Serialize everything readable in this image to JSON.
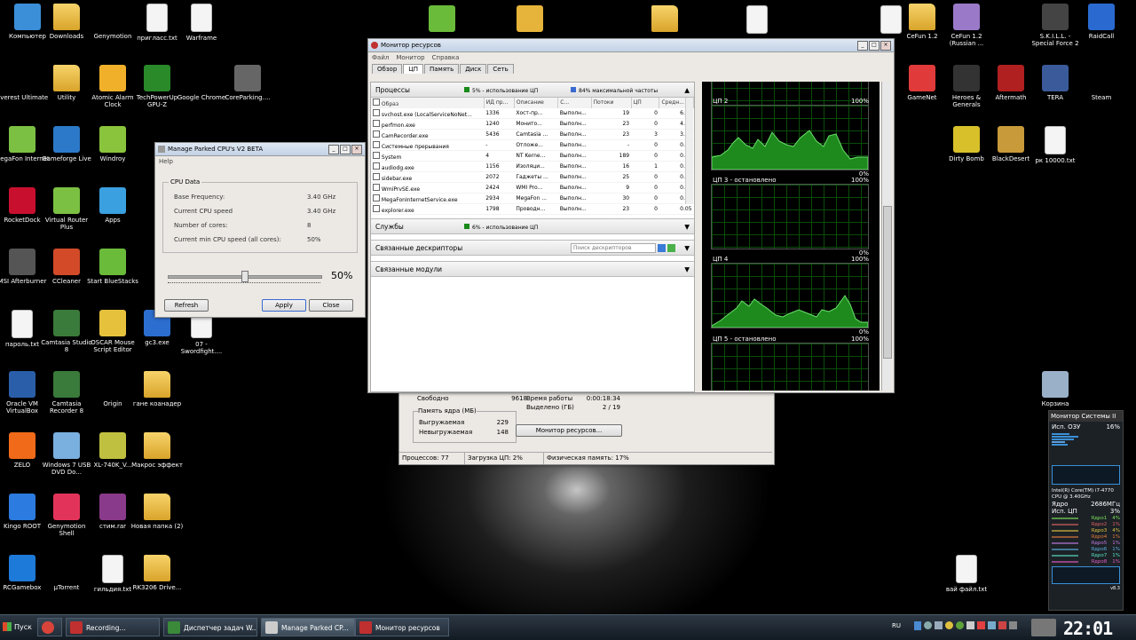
{
  "desktop_icons": [
    {
      "label": "Компьютер",
      "icon": "computer-icon",
      "color": "#3b8fd8"
    },
    {
      "label": "Downloads",
      "icon": "folder-icon",
      "color": "#e8b84a"
    },
    {
      "label": "Genymotion",
      "icon": "genymotion-icon",
      "color": "#e2345a"
    },
    {
      "label": "пригласс.txt",
      "icon": "text-file-icon",
      "color": "#f4f4f4"
    },
    {
      "label": "Warframe",
      "icon": "document-icon",
      "color": "#f4f4f4"
    },
    {
      "label": "Everest Ultimate",
      "icon": "info-icon",
      "color": "#e87d13"
    },
    {
      "label": "Utility",
      "icon": "folder-icon",
      "color": "#e8b84a"
    },
    {
      "label": "Atomic Alarm Clock",
      "icon": "alarm-clock-icon",
      "color": "#f0b02a"
    },
    {
      "label": "TechPowerUp GPU-Z",
      "icon": "gpu-icon",
      "color": "#2a8a2a"
    },
    {
      "label": "Google Chrome",
      "icon": "chrome-icon",
      "color": "#d9443a"
    },
    {
      "label": "CoreParking....",
      "icon": "chip-icon",
      "color": "#666"
    },
    {
      "label": "MegaFon Internet",
      "icon": "signal-icon",
      "color": "#7bc043"
    },
    {
      "label": "Gameforge Live",
      "icon": "gameforge-icon",
      "color": "#2c79c9"
    },
    {
      "label": "Windroy",
      "icon": "android-icon",
      "color": "#8ac43c"
    },
    {
      "label": "RocketDock",
      "icon": "rocket-icon",
      "color": "#c8102e"
    },
    {
      "label": "Virtual Router Plus",
      "icon": "signal-icon",
      "color": "#7bc043"
    },
    {
      "label": "Apps",
      "icon": "apps-icon",
      "color": "#3aa0e0"
    },
    {
      "label": "MSI Afterburner",
      "icon": "afterburner-icon",
      "color": "#555"
    },
    {
      "label": "CCleaner",
      "icon": "ccleaner-icon",
      "color": "#d24a28"
    },
    {
      "label": "Start BlueStacks",
      "icon": "bluestacks-icon",
      "color": "#6bbb3a"
    },
    {
      "label": "пароль.txt",
      "icon": "text-file-icon",
      "color": "#f4f4f4"
    },
    {
      "label": "Camtasia Studio 8",
      "icon": "camtasia-icon",
      "color": "#3a7a3a"
    },
    {
      "label": "OSCAR Mouse Script Editor",
      "icon": "oscar-icon",
      "color": "#e6c23c"
    },
    {
      "label": "gc3.exe",
      "icon": "exe-icon",
      "color": "#2c6ed0"
    },
    {
      "label": "07 - Swordfight....",
      "icon": "media-file-icon",
      "color": "#f4f4f4"
    },
    {
      "label": "Oracle VM VirtualBox",
      "icon": "virtualbox-icon",
      "color": "#2b5ea8"
    },
    {
      "label": "Camtasia Recorder 8",
      "icon": "camtasia-recorder-icon",
      "color": "#3a7a3a"
    },
    {
      "label": "Origin",
      "icon": "origin-icon",
      "color": "#f26c1f"
    },
    {
      "label": "гане коанадер",
      "icon": "folder-icon",
      "color": "#e8b84a"
    },
    {
      "label": "ZELO",
      "icon": "zelo-icon",
      "color": "#f06a19"
    },
    {
      "label": "Windows 7 USB DVD Do...",
      "icon": "usb-icon",
      "color": "#7ab0e0"
    },
    {
      "label": "XL-740K_V...",
      "icon": "xl-icon",
      "color": "#c0c040"
    },
    {
      "label": "Макрос эффект",
      "icon": "folder-icon",
      "color": "#e8b84a"
    },
    {
      "label": "Kingo ROOT",
      "icon": "kingo-icon",
      "color": "#2c7be0"
    },
    {
      "label": "Genymotion Shell",
      "icon": "genymotion-shell-icon",
      "color": "#e2345a"
    },
    {
      "label": "стим.rar",
      "icon": "archive-icon",
      "color": "#8a3a8a"
    },
    {
      "label": "Новая папка (2)",
      "icon": "folder-icon",
      "color": "#e8b84a"
    },
    {
      "label": "RCGamebox",
      "icon": "rcgamebox-icon",
      "color": "#1e7ad8"
    },
    {
      "label": "µTorrent",
      "icon": "utorrent-icon",
      "color": "#5ea23a"
    },
    {
      "label": "гильдия.txt",
      "icon": "text-file-icon",
      "color": "#f4f4f4"
    },
    {
      "label": "RK3206 Drive...",
      "icon": "folder-icon",
      "color": "#e8b84a"
    },
    {
      "label": "CeFun 1.2",
      "icon": "folder-icon",
      "color": "#e8b84a"
    },
    {
      "label": "CeFun 1.2 (Russian ...",
      "icon": "cefun-icon",
      "color": "#9a7ac8"
    },
    {
      "label": "S.K.I.L.L. - Special Force 2",
      "icon": "sf2-icon",
      "color": "#444"
    },
    {
      "label": "RaidCall",
      "icon": "raidcall-icon",
      "color": "#2a6ad0"
    },
    {
      "label": "GameNet",
      "icon": "gamenet-icon",
      "color": "#e03a3a"
    },
    {
      "label": "Heroes & Generals",
      "icon": "hg-icon",
      "color": "#333"
    },
    {
      "label": "Aftermath",
      "icon": "aftermath-icon",
      "color": "#b02020"
    },
    {
      "label": "TERA",
      "icon": "tera-icon",
      "color": "#3a5a9a"
    },
    {
      "label": "Steam",
      "icon": "steam-icon",
      "color": "#1b4a7a"
    },
    {
      "label": "Dirty Bomb",
      "icon": "dirtybomb-icon",
      "color": "#d8c02a"
    },
    {
      "label": "BlackDesert",
      "icon": "blackdesert-icon",
      "color": "#c89a3a"
    },
    {
      "label": "рк 10000.txt",
      "icon": "text-file-icon",
      "color": "#f4f4f4"
    },
    {
      "label": "Корзина",
      "icon": "recycle-bin-icon",
      "color": "#9ab0c8"
    },
    {
      "label": "вай файл.txt",
      "icon": "text-file-icon",
      "color": "#f4f4f4"
    }
  ],
  "top_icons": [
    {
      "icon": "bluestacks-icon",
      "color": "#6bbb3a"
    },
    {
      "icon": "uac-shield-icon",
      "color": "#e6b43a"
    },
    {
      "icon": "folder-icon",
      "color": "#e8b84a"
    },
    {
      "icon": "mp3-file-icon",
      "color": "#f4f4f4"
    },
    {
      "icon": "search-file-icon",
      "color": "#f4f4f4"
    }
  ],
  "resmon": {
    "title": "Монитор ресурсов",
    "menu": [
      "Файл",
      "Монитор",
      "Справка"
    ],
    "tabs": [
      "Обзор",
      "ЦП",
      "Память",
      "Диск",
      "Сеть"
    ],
    "processes_header": "Процессы",
    "processes_usage": "5% - использование ЦП",
    "processes_freq": "84% максимальной частоты",
    "columns": [
      "Образ",
      "ИД пр...",
      "Описание",
      "С...",
      "Потоки",
      "ЦП",
      "Средн..."
    ],
    "rows": [
      [
        "svchost.exe (LocalServiceNoNet...",
        "1336",
        "Хост-пр...",
        "Выполн...",
        "19",
        "0",
        "6.03"
      ],
      [
        "perfmon.exe",
        "1240",
        "Монито...",
        "Выполн...",
        "23",
        "0",
        "4.27"
      ],
      [
        "CamRecorder.exe",
        "5436",
        "Camtasia ...",
        "Выполн...",
        "23",
        "3",
        "3.83"
      ],
      [
        "Системные прерывания",
        "-",
        "Отложе...",
        "Выполн...",
        "-",
        "0",
        "0.91"
      ],
      [
        "System",
        "4",
        "NT Kerne...",
        "Выполн...",
        "189",
        "0",
        "0.85"
      ],
      [
        "audiodg.exe",
        "1156",
        "Изоляци...",
        "Выполн...",
        "16",
        "1",
        "0.35"
      ],
      [
        "sidebar.exe",
        "2072",
        "Гаджеты ...",
        "Выполн...",
        "25",
        "0",
        "0.35"
      ],
      [
        "WmiPrvSE.exe",
        "2424",
        "WMI Pro...",
        "Выполн...",
        "9",
        "0",
        "0.32"
      ],
      [
        "MegaFonInternetService.exe",
        "2934",
        "MegaFon ...",
        "Выполн...",
        "30",
        "0",
        "0.09"
      ],
      [
        "explorer.exe",
        "1798",
        "Проводн...",
        "Выполн...",
        "23",
        "0",
        "0.05"
      ]
    ],
    "services_header": "Службы",
    "services_usage": "6% - использование ЦП",
    "handles_header": "Связанные дескрипторы",
    "handles_search_placeholder": "Поиск дескрипторов",
    "modules_header": "Связанные модули",
    "cpu_graphs": [
      {
        "label": "",
        "top": "",
        "bottom": "0%",
        "parked": false,
        "partial": true
      },
      {
        "label": "ЦП 2",
        "top": "100%",
        "bottom": "0%",
        "parked": false
      },
      {
        "label": "ЦП 3 - остановлено",
        "top": "100%",
        "bottom": "0%",
        "parked": true
      },
      {
        "label": "ЦП 4",
        "top": "100%",
        "bottom": "0%",
        "parked": false
      },
      {
        "label": "ЦП 5 - остановлено",
        "top": "100%",
        "bottom": "",
        "parked": true
      }
    ]
  },
  "taskmgr": {
    "free_label": "Свободно",
    "free_value": "9618",
    "uptime_label": "Время работы",
    "uptime_value": "0:00:18:34",
    "committed_label": "Выделено (ГБ)",
    "committed_value": "2 / 19",
    "kernel_memory_label": "Память ядра (МБ)",
    "paged_label": "Выгружаемая",
    "paged_value": "229",
    "nonpaged_label": "Невыгружаемая",
    "nonpaged_value": "148",
    "resmon_button": "Монитор ресурсов...",
    "status_processes": "Процессов: 77",
    "status_cpu": "Загрузка ЦП: 2%",
    "status_memory": "Физическая память: 17%"
  },
  "parked": {
    "title": "Manage Parked CPU's V2 BETA",
    "menu": "Help",
    "group": "CPU Data",
    "fields": [
      {
        "label": "Base Frequency:",
        "value": "3.40 GHz"
      },
      {
        "label": "Current CPU speed",
        "value": "3.40 GHz"
      },
      {
        "label": "Number of cores:",
        "value": "8"
      },
      {
        "label": "Current min CPU speed (all cores):",
        "value": "50%"
      }
    ],
    "slider_value": "50%",
    "slider_fraction": 0.5,
    "refresh": "Refresh",
    "apply": "Apply",
    "close": "Close"
  },
  "gadget": {
    "title": "Монитор Системы II",
    "ram_label": "Исп. ОЗУ",
    "ram_value": "16%",
    "cpu_name": "Intel(R) Core(TM) i7-4770 CPU @ 3.40GHz",
    "core_label": "Ядро",
    "core_freq": "2686МГц",
    "cpu_use_label": "Исп. ЦП",
    "cpu_use_value": "3%",
    "cores": [
      {
        "label": "Ядро1",
        "value": "4%",
        "color": "#7ae05a"
      },
      {
        "label": "Ядро2",
        "value": "1%",
        "color": "#e06060"
      },
      {
        "label": "Ядро3",
        "value": "4%",
        "color": "#e0c040"
      },
      {
        "label": "Ядро4",
        "value": "1%",
        "color": "#e07a3a"
      },
      {
        "label": "Ядро5",
        "value": "1%",
        "color": "#c07ae0"
      },
      {
        "label": "Ядро6",
        "value": "1%",
        "color": "#5ab0e0"
      },
      {
        "label": "Ядро7",
        "value": "1%",
        "color": "#5ae0c0"
      },
      {
        "label": "Ядро8",
        "value": "1%",
        "color": "#e05ac0"
      }
    ],
    "footer": "v8.3"
  },
  "taskbar": {
    "start": "Пуск",
    "tasks": [
      {
        "label": "",
        "icon": "chrome-icon",
        "color": "#d9443a"
      },
      {
        "label": "Recording...",
        "icon": "camtasia-recorder-icon",
        "color": "#c03030"
      },
      {
        "label": "Диспетчер задач W...",
        "icon": "task-manager-icon",
        "color": "#3a8a3a"
      },
      {
        "label": "Manage Parked CP...",
        "icon": "parked-cpu-icon",
        "color": "#cccccc"
      },
      {
        "label": "Монитор ресурсов",
        "icon": "resource-monitor-icon",
        "color": "#c03030"
      }
    ],
    "lang": "RU",
    "clock": "22:01"
  }
}
